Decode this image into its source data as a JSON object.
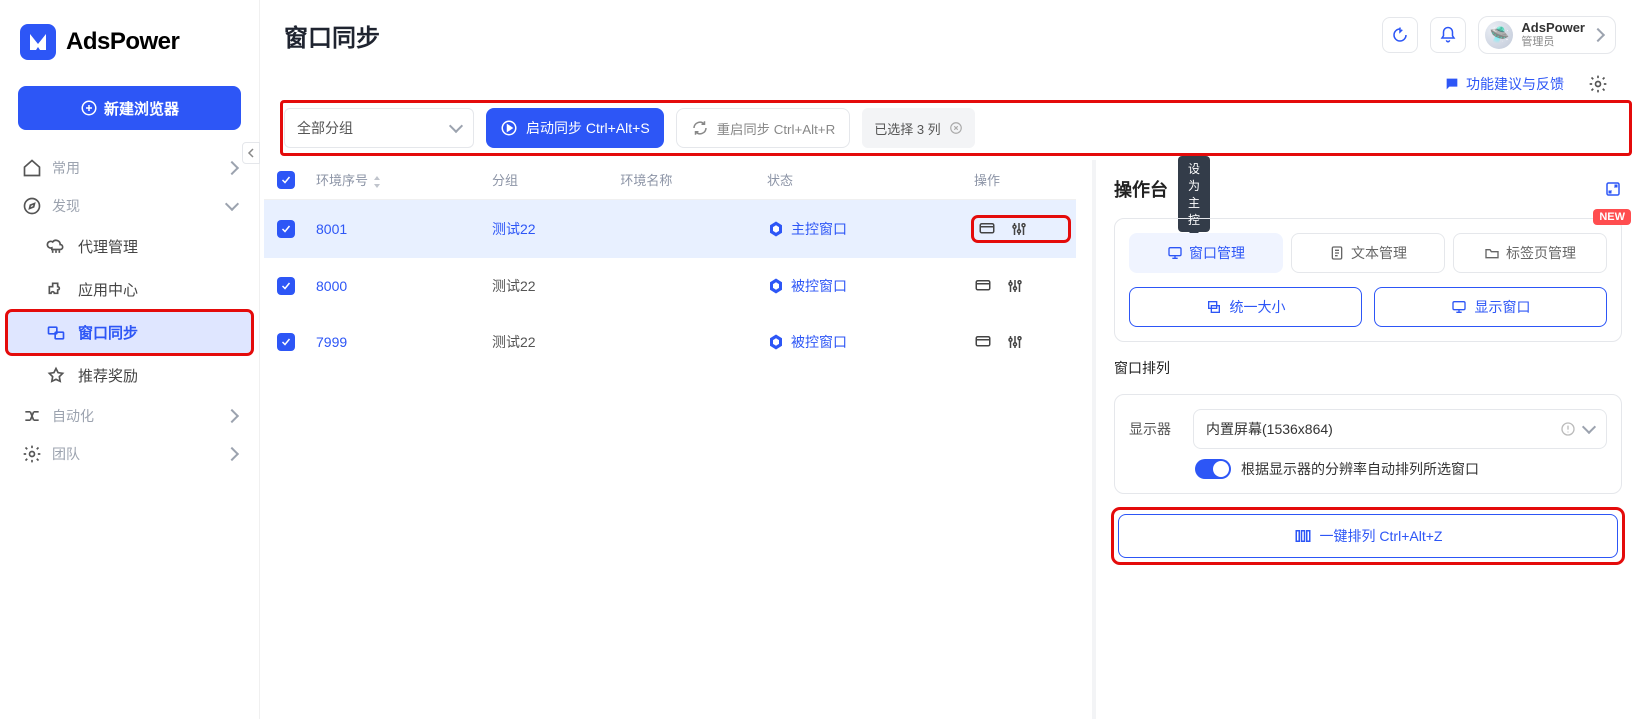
{
  "brand": "AdsPower",
  "new_browser": "新建浏览器",
  "nav": {
    "common": "常用",
    "discover": "发现",
    "proxy": "代理管理",
    "apps": "应用中心",
    "sync": "窗口同步",
    "rewards": "推荐奖励",
    "automation": "自动化",
    "team": "团队"
  },
  "header": {
    "title": "窗口同步",
    "user_name": "AdsPower",
    "user_role": "管理员",
    "feedback": "功能建议与反馈"
  },
  "toolbar": {
    "group_select": "全部分组",
    "start_sync": "启动同步 Ctrl+Alt+S",
    "restart_sync": "重启同步 Ctrl+Alt+R",
    "selected": "已选择 3 列"
  },
  "table": {
    "cols": {
      "seq": "环境序号",
      "group": "分组",
      "name": "环境名称",
      "status": "状态",
      "ops": "操作"
    },
    "tooltip_set_master": "设为主控",
    "rows": [
      {
        "seq": "8001",
        "group": "测试22",
        "name": "",
        "status": "主控窗口",
        "selected": true,
        "master": true
      },
      {
        "seq": "8000",
        "group": "测试22",
        "name": "",
        "status": "被控窗口",
        "selected": true,
        "master": false
      },
      {
        "seq": "7999",
        "group": "测试22",
        "name": "",
        "status": "被控窗口",
        "selected": true,
        "master": false
      }
    ]
  },
  "panel": {
    "title": "操作台",
    "new_badge": "NEW",
    "tabs": {
      "window": "窗口管理",
      "text": "文本管理",
      "tabs_mgmt": "标签页管理"
    },
    "btn_uniform": "统一大小",
    "btn_show": "显示窗口",
    "arrange_label": "窗口排列",
    "display_label": "显示器",
    "display_value": "内置屏幕(1536x864)",
    "auto_arrange": "根据显示器的分辨率自动排列所选窗口",
    "one_click": "一键排列 Ctrl+Alt+Z"
  }
}
